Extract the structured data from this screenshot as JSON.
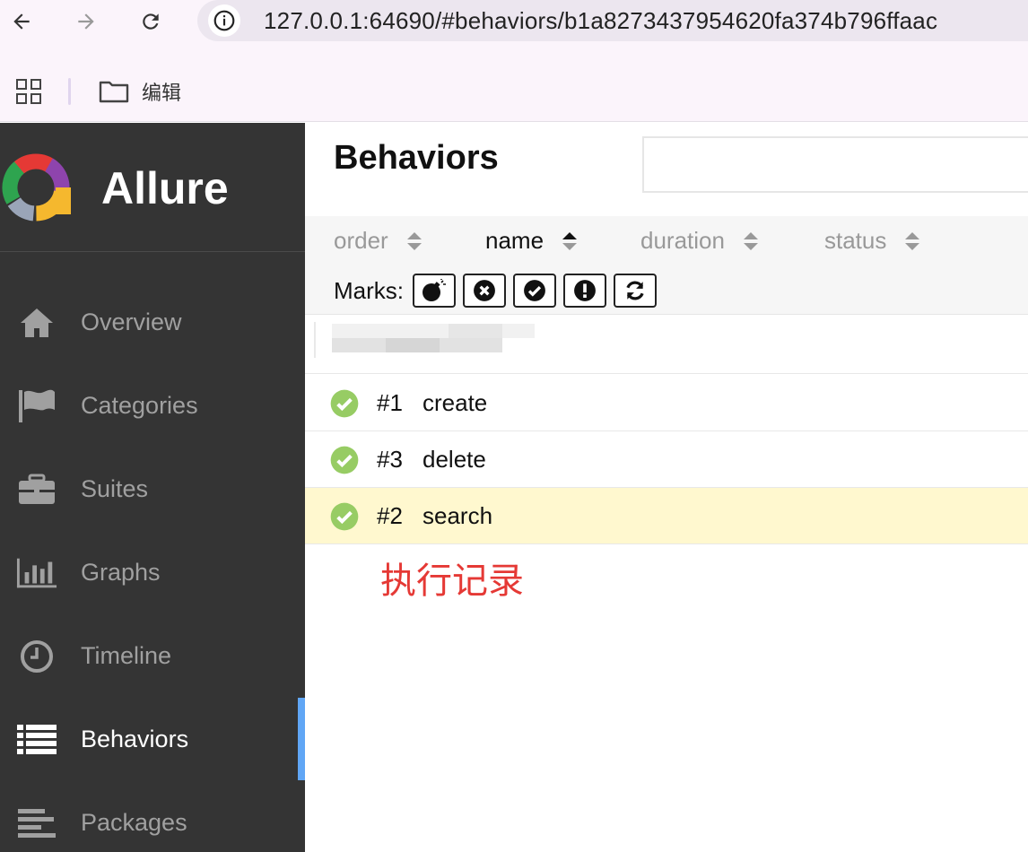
{
  "browser": {
    "url": "127.0.0.1:64690/#behaviors/b1a8273437954620fa374b796ffaac",
    "bookmark_label": "编辑"
  },
  "sidebar": {
    "brand": "Allure",
    "items": [
      {
        "label": "Overview",
        "icon": "home-icon"
      },
      {
        "label": "Categories",
        "icon": "flag-icon"
      },
      {
        "label": "Suites",
        "icon": "briefcase-icon"
      },
      {
        "label": "Graphs",
        "icon": "bar-chart-icon"
      },
      {
        "label": "Timeline",
        "icon": "clock-icon"
      },
      {
        "label": "Behaviors",
        "icon": "list-icon",
        "active": true
      },
      {
        "label": "Packages",
        "icon": "align-left-icon"
      }
    ],
    "accent_color": "#60a6f5"
  },
  "main": {
    "title": "Behaviors",
    "sort_columns": [
      {
        "label": "order",
        "active": false
      },
      {
        "label": "name",
        "active": true
      },
      {
        "label": "duration",
        "active": false
      },
      {
        "label": "status",
        "active": false
      }
    ],
    "marks_label": "Marks:",
    "marks": [
      "bomb-icon",
      "times-circle-icon",
      "check-circle-icon",
      "exclamation-circle-icon",
      "refresh-icon"
    ],
    "rows": [
      {
        "num": "#1",
        "name": "create",
        "status": "passed"
      },
      {
        "num": "#3",
        "name": "delete",
        "status": "passed"
      },
      {
        "num": "#2",
        "name": "search",
        "status": "passed",
        "selected": true
      }
    ],
    "annotation": "执行记录",
    "passed_color": "#97cc64",
    "annotation_color": "#e53935"
  }
}
